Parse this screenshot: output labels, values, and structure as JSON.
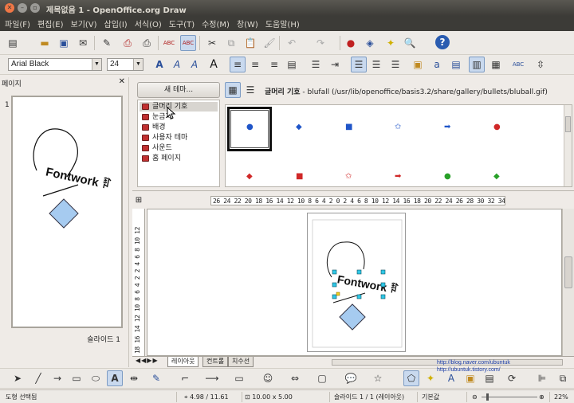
{
  "window": {
    "title": "제목없음 1 - OpenOffice.org Draw"
  },
  "menu": [
    "파일(F)",
    "편집(E)",
    "보기(V)",
    "삽입(I)",
    "서식(O)",
    "도구(T)",
    "수정(M)",
    "창(W)",
    "도움말(H)"
  ],
  "font": {
    "name": "Arial Black",
    "size": "24"
  },
  "slides_panel": {
    "title": "페이지",
    "close": "✕",
    "number": "1",
    "label": "슬라이드 1",
    "thumb_text": "Fontwork ꆌ"
  },
  "gallery": {
    "new_theme_label": "새 테마...",
    "themes": [
      "글머리 기호",
      "눈금자",
      "배경",
      "사용자 테마",
      "사운드",
      "홈 페이지"
    ],
    "selected_theme": "글머리 기호",
    "header_name": "글머리 기호",
    "header_path": " - blufall (/usr/lib/openoffice/basis3.2/share/gallery/bullets/bluball.gif)",
    "bullets_row1": [
      "circle-blue",
      "diamond-blue",
      "square-blue",
      "star-blue",
      "arrow-blue",
      "circle-red"
    ],
    "bullets_row2": [
      "diamond-red",
      "square-red",
      "star-red",
      "arrow-red",
      "circle-green",
      "diamond-green"
    ]
  },
  "rulers": {
    "horizontal": "26 24 22 20 18 16 14 12 10 8 6 4 2 0 2 4 6 8 10 12 14 16 18 20 22 24 26 28 30 32 34",
    "vertical": "18 16 14 12 10 8 6 4 2 2 4 6 8 10 12"
  },
  "canvas": {
    "fontwork_text": "Fontwork ꆌ"
  },
  "tabs": [
    "레이아웃",
    "컨트롤",
    "치수선"
  ],
  "active_tab": "레이아웃",
  "urls": [
    "http://blog.naver.com/ubuntuk",
    "http://ubuntuk.tistory.com/"
  ],
  "status": {
    "selection": "도형 선택됨",
    "position": "4.98 / 11.61",
    "size": "10.00 x 5.00",
    "slide": "슬라이드 1 / 1 (레이아웃)",
    "layout": "기본값",
    "zoom": "22%"
  },
  "colors": {
    "blue_bullet": "#1f55c8",
    "red_bullet": "#d02828",
    "green_bullet": "#28a028",
    "diamond_fill": "#a6cbf0"
  }
}
